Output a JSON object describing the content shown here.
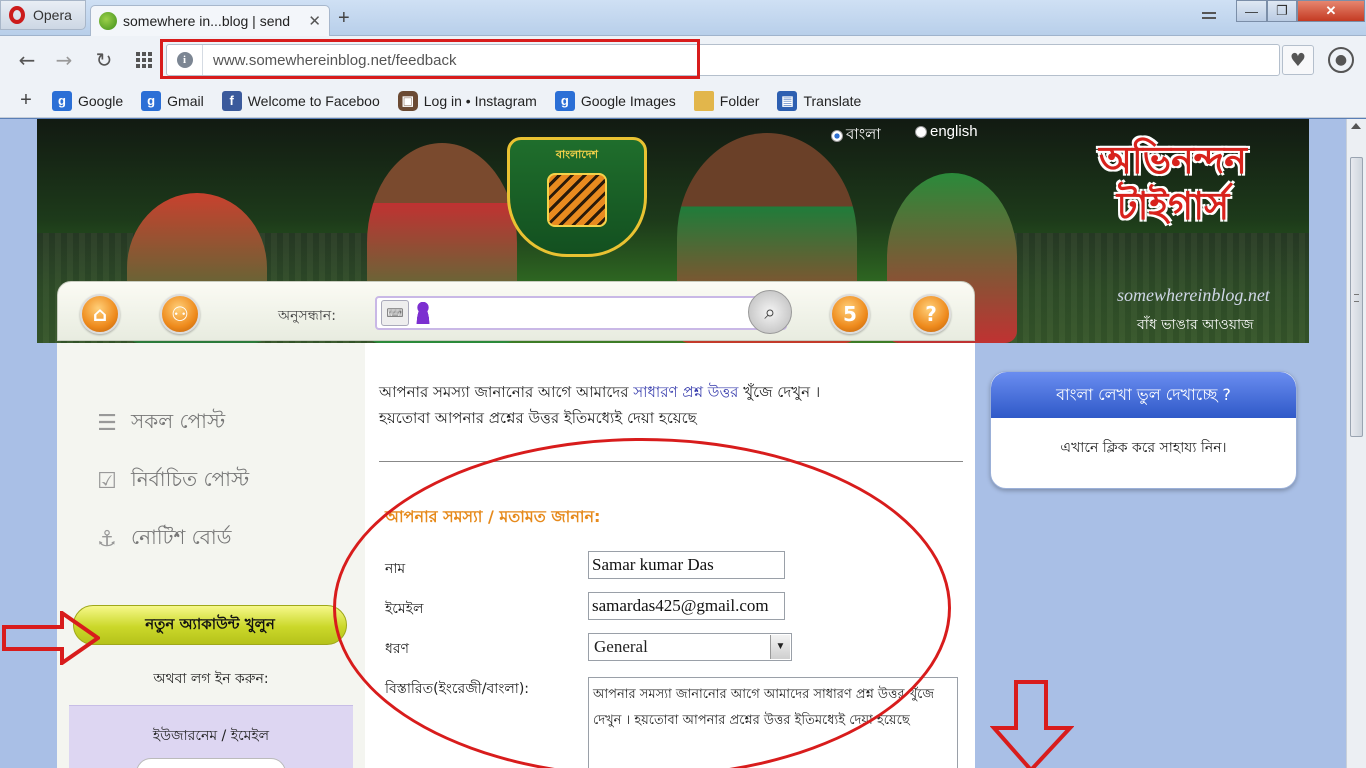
{
  "browser": {
    "menu_label": "Opera",
    "tab_title": "somewhere in...blog | send",
    "tab_close": "✕",
    "new_tab": "+",
    "url_host": "www.somewhereinblog.net",
    "url_path": "/feedback",
    "win_min": "—",
    "win_max": "❐",
    "win_close": "✕"
  },
  "bookmarks": {
    "add": "+",
    "items": [
      {
        "label": "Google",
        "icon": "google-icon"
      },
      {
        "label": "Gmail",
        "icon": "google-icon"
      },
      {
        "label": "Welcome to Faceboo",
        "icon": "facebook-icon"
      },
      {
        "label": "Log in • Instagram",
        "icon": "instagram-icon"
      },
      {
        "label": "Google Images",
        "icon": "google-icon"
      },
      {
        "label": "Folder",
        "icon": "folder-icon"
      },
      {
        "label": "Translate",
        "icon": "translate-icon"
      }
    ]
  },
  "banner": {
    "crest_text": "বাংলাদেশ",
    "lang_bangla": "বাংলা",
    "lang_english": "english",
    "congrats_line1": "অভিনন্দন",
    "congrats_line2": "টাইগার্স",
    "site_logo": "somewhereinblog.net",
    "site_tagline": "বাঁধ ভাঙার আওয়াজ"
  },
  "topbar": {
    "search_label": "অনুসন্ধান:",
    "search_value": ""
  },
  "sidebar": {
    "items": [
      {
        "label": "সকল পোস্ট",
        "icon": "list-icon"
      },
      {
        "label": "নির্বাচিত পোস্ট",
        "icon": "checklist-icon"
      },
      {
        "label": "নোটিশ বোর্ড",
        "icon": "pin-icon"
      }
    ],
    "new_account": "নতুন অ্যাকাউন্ট খুলুন",
    "or_login": "অথবা লগ ইন করুন:",
    "username_label": "ইউজারনেম / ইমেইল"
  },
  "main": {
    "intro_pre": "আপনার সমস্যা জানানোর আগে আমাদের ",
    "intro_link": "সাধারণ প্রশ্ন উত্তর",
    "intro_post": " খুঁজে দেখুন ।",
    "intro_line2": "হয়তোবা আপনার প্রশ্নের উত্তর ইতিমধ্যেই দেয়া হয়েছে",
    "form_title": "আপনার সমস্যা / মতামত জানান:",
    "name_label": "নাম",
    "name_value": "Samar kumar Das",
    "email_label": "ইমেইল",
    "email_value": "samardas425@gmail.com",
    "type_label": "ধরণ",
    "type_value": "General",
    "detail_label": "বিস্তারিত(ইংরেজী/বাংলা):",
    "detail_value": "আপনার সমস্যা জানানোর আগে আমাদের সাধারণ প্রশ্ন উত্তর খুঁজে দেখুন । হয়তোবা আপনার প্রশ্নের উত্তর ইতিমধ্যেই দেয়া হয়েছে"
  },
  "help_box": {
    "title": "বাংলা লেখা ভুল দেখাচ্ছে ?",
    "body": "এখানে ক্লিক করে সাহায্য নিন।"
  },
  "colors": {
    "annotation_red": "#d81c1c",
    "form_title_orange": "#e68a1c",
    "help_header_blue": "#2f59c8"
  }
}
